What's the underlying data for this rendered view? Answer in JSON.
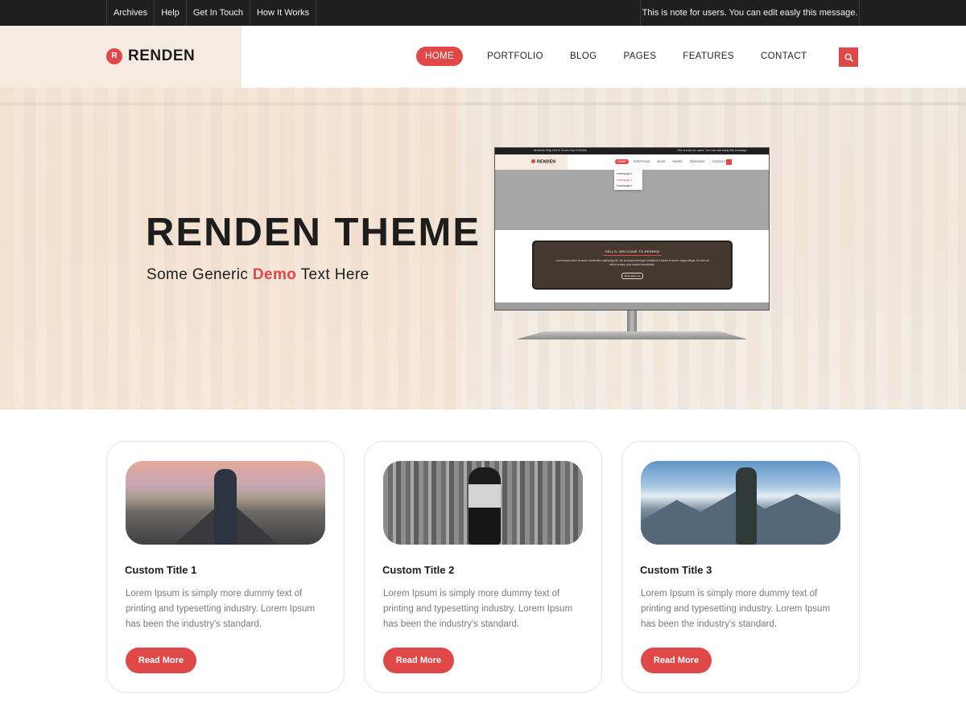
{
  "topbar": {
    "links": [
      "Archives",
      "Help",
      "Get In Touch",
      "How It Works"
    ],
    "note": "This is note for users. You can edit easly this message."
  },
  "header": {
    "logo_mark": "R",
    "logo_text": "RENDEN",
    "nav": [
      "HOME",
      "PORTFOLIO",
      "BLOG",
      "PAGES",
      "FEATURES",
      "CONTACT"
    ],
    "active_nav": "HOME",
    "search_icon": "search-icon"
  },
  "hero": {
    "title": "RENDEN THEME",
    "subtitle_before": "Some Generic ",
    "subtitle_highlight": "Demo",
    "subtitle_after": " Text Here"
  },
  "monitor": {
    "topbar_links": "Archives   Help   Get In Touch   How It Works",
    "topbar_note": "This is note for users. You can edit easly this message.",
    "logo": "RENDEN",
    "nav": [
      "HOME",
      "PORTFOLIO",
      "BLOG",
      "PAGES",
      "FEATURES",
      "CONTACT"
    ],
    "dropdown": [
      "Homepage 1",
      "Homepage 2",
      "Homepage 3"
    ],
    "card_heading": "HELLO, WELCOME TO RENDEN",
    "card_text": "Lorem ipsum dolor sit amet, consectetur adipiscing elit, sed do eiusmod tempor incididunt ut labore et dolore magna aliqua. Ut enim ad minim veniam, quis nostrud exercitation.",
    "card_button": "More About Us"
  },
  "cards": [
    {
      "title": "Custom Title 1",
      "text": "Lorem Ipsum is simply more dummy text of printing and typesetting industry. Lorem Ipsum has been the industry's standard.",
      "button": "Read More"
    },
    {
      "title": "Custom Title 2",
      "text": "Lorem Ipsum is simply more dummy text of printing and typesetting industry. Lorem Ipsum has been the industry's standard.",
      "button": "Read More"
    },
    {
      "title": "Custom Title 3",
      "text": "Lorem Ipsum is simply more dummy text of printing and typesetting industry. Lorem Ipsum has been the industry's standard.",
      "button": "Read More"
    }
  ],
  "colors": {
    "accent": "#e04848",
    "topbar_bg": "#1f1f1f",
    "logo_panel_bg": "#f6ebe1"
  }
}
